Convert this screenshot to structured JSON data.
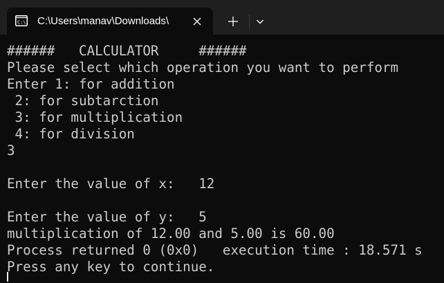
{
  "tab": {
    "title": "C:\\Users\\manav\\Downloads\\",
    "icon": "console-icon",
    "close_icon": "close-icon"
  },
  "toolbar": {
    "new_tab_icon": "plus-icon",
    "dropdown_icon": "chevron-down-icon"
  },
  "colors": {
    "background": "#0c0c0c",
    "tabbar": "#1f1f1f",
    "text": "#cccccc"
  },
  "console": {
    "lines": [
      "######   CALCULATOR     ######",
      "Please select which operation you want to perform",
      "Enter 1: for addition",
      " 2: for subtarction",
      " 3: for multiplication",
      " 4: for division",
      "3",
      "",
      "Enter the value of x:   12",
      "",
      "Enter the value of y:   5",
      "multiplication of 12.00 and 5.00 is 60.00",
      "Process returned 0 (0x0)   execution time : 18.571 s",
      "Press any key to continue."
    ]
  }
}
